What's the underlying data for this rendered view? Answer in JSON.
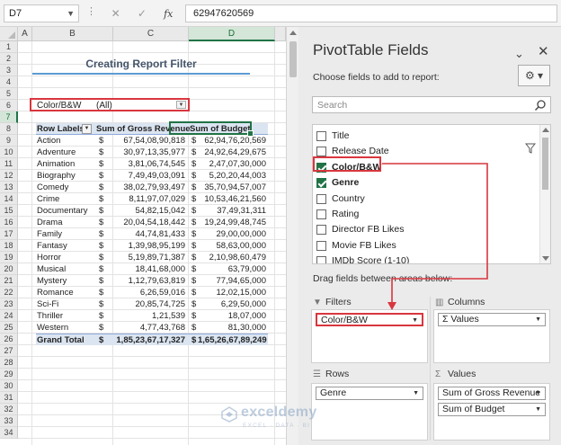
{
  "formula_bar": {
    "name_box": "D7",
    "formula": "62947620569",
    "fx_label": "fx"
  },
  "columns": [
    "A",
    "B",
    "C",
    "D"
  ],
  "rows": [
    "1",
    "2",
    "3",
    "4",
    "5",
    "6",
    "7",
    "8",
    "9",
    "10",
    "11",
    "12",
    "13",
    "14",
    "15",
    "16",
    "17",
    "18",
    "19",
    "20",
    "21",
    "22",
    "23",
    "24",
    "25",
    "26",
    "27",
    "28",
    "29",
    "30",
    "31",
    "32",
    "33",
    "34"
  ],
  "title": "Creating Report Filter",
  "report_filter": {
    "field": "Color/B&W",
    "value": "(All)"
  },
  "pivot": {
    "headers": {
      "row_labels": "Row Labels",
      "gross": "Sum of Gross Revenue",
      "budget": "Sum of Budget"
    },
    "currency": "$",
    "rows": [
      {
        "label": "Action",
        "gross": "67,54,08,90,818",
        "budget": "62,94,76,20,569"
      },
      {
        "label": "Adventure",
        "gross": "30,97,13,35,977",
        "budget": "24,92,64,29,675"
      },
      {
        "label": "Animation",
        "gross": "3,81,06,74,545",
        "budget": "2,47,07,30,000"
      },
      {
        "label": "Biography",
        "gross": "7,49,49,03,091",
        "budget": "5,20,20,44,003"
      },
      {
        "label": "Comedy",
        "gross": "38,02,79,93,497",
        "budget": "35,70,94,57,007"
      },
      {
        "label": "Crime",
        "gross": "8,11,97,07,029",
        "budget": "10,53,46,21,560"
      },
      {
        "label": "Documentary",
        "gross": "54,82,15,042",
        "budget": "37,49,31,311"
      },
      {
        "label": "Drama",
        "gross": "20,04,54,18,442",
        "budget": "19,24,99,48,745"
      },
      {
        "label": "Family",
        "gross": "44,74,81,433",
        "budget": "29,00,00,000"
      },
      {
        "label": "Fantasy",
        "gross": "1,39,98,95,199",
        "budget": "58,63,00,000"
      },
      {
        "label": "Horror",
        "gross": "5,19,89,71,387",
        "budget": "2,10,98,60,479"
      },
      {
        "label": "Musical",
        "gross": "18,41,68,000",
        "budget": "63,79,000"
      },
      {
        "label": "Mystery",
        "gross": "1,12,79,63,819",
        "budget": "77,94,65,000"
      },
      {
        "label": "Romance",
        "gross": "6,26,59,016",
        "budget": "12,02,15,000"
      },
      {
        "label": "Sci-Fi",
        "gross": "20,85,74,725",
        "budget": "6,29,50,000"
      },
      {
        "label": "Thriller",
        "gross": "1,21,539",
        "budget": "18,07,000"
      },
      {
        "label": "Western",
        "gross": "4,77,43,768",
        "budget": "81,30,000"
      }
    ],
    "total": {
      "label": "Grand Total",
      "gross": "1,85,23,67,17,327",
      "budget": "1,65,26,67,89,249"
    }
  },
  "pane": {
    "title": "PivotTable Fields",
    "choose_label": "Choose fields to add to report:",
    "search_placeholder": "Search",
    "fields": [
      {
        "label": "Title",
        "checked": false,
        "bold": false
      },
      {
        "label": "Release Date",
        "checked": false,
        "bold": false
      },
      {
        "label": "Color/B&W",
        "checked": true,
        "bold": true
      },
      {
        "label": "Genre",
        "checked": true,
        "bold": true
      },
      {
        "label": "Country",
        "checked": false,
        "bold": false
      },
      {
        "label": "Rating",
        "checked": false,
        "bold": false
      },
      {
        "label": "Director FB Likes",
        "checked": false,
        "bold": false
      },
      {
        "label": "Movie FB Likes",
        "checked": false,
        "bold": false
      },
      {
        "label": "IMDb Score (1-10)",
        "checked": false,
        "bold": false
      }
    ],
    "drag_label": "Drag fields between areas below:",
    "areas": {
      "filters": {
        "label": "Filters",
        "items": [
          "Color/B&W"
        ]
      },
      "columns": {
        "label": "Columns",
        "items": [
          "Values"
        ]
      },
      "rows": {
        "label": "Rows",
        "items": [
          "Genre"
        ]
      },
      "values": {
        "label": "Values",
        "items": [
          "Sum of Gross Revenue",
          "Sum of Budget"
        ]
      }
    }
  },
  "watermark": {
    "name": "exceldemy",
    "tagline": "EXCEL · DATA · BI"
  },
  "colors": {
    "accent_green": "#217346",
    "highlight_red": "#d9363e",
    "pivot_header": "#dbe5f1",
    "title_line": "#5b9bd5"
  }
}
